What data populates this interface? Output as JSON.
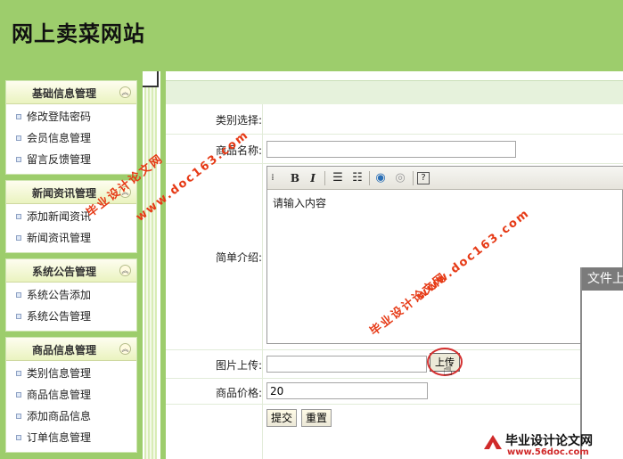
{
  "site": {
    "title": "网上卖菜网站"
  },
  "sidebar": {
    "groups": [
      {
        "title": "基础信息管理",
        "items": [
          "修改登陆密码",
          "会员信息管理",
          "留言反馈管理"
        ]
      },
      {
        "title": "新闻资讯管理",
        "items": [
          "添加新闻资讯",
          "新闻资讯管理"
        ]
      },
      {
        "title": "系统公告管理",
        "items": [
          "系统公告添加",
          "系统公告管理"
        ]
      },
      {
        "title": "商品信息管理",
        "items": [
          "类别信息管理",
          "商品信息管理",
          "添加商品信息",
          "订单信息管理"
        ]
      }
    ]
  },
  "form": {
    "category_label": "类别选择:",
    "name_label": "商品名称:",
    "name_value": "",
    "intro_label": "简单介绍:",
    "editor_placeholder": "请输入内容",
    "image_label": "图片上传:",
    "image_value": "",
    "upload_button": "上传",
    "price_label": "商品价格:",
    "price_value": "20",
    "submit_button": "提交",
    "reset_button": "重置"
  },
  "editor_toolbar": {
    "bold": "B",
    "italic": "I",
    "help": "?"
  },
  "file_panel": {
    "title": "文件上"
  },
  "watermarks": {
    "text_a": "毕业设计论文网",
    "text_b": "www.doc163.com"
  },
  "footer": {
    "logo_text": "毕业设计论文网",
    "logo_url": "www.56doc.com"
  },
  "colors": {
    "accent_green": "#9dcd6c",
    "watermark_red": "#e63a16"
  }
}
